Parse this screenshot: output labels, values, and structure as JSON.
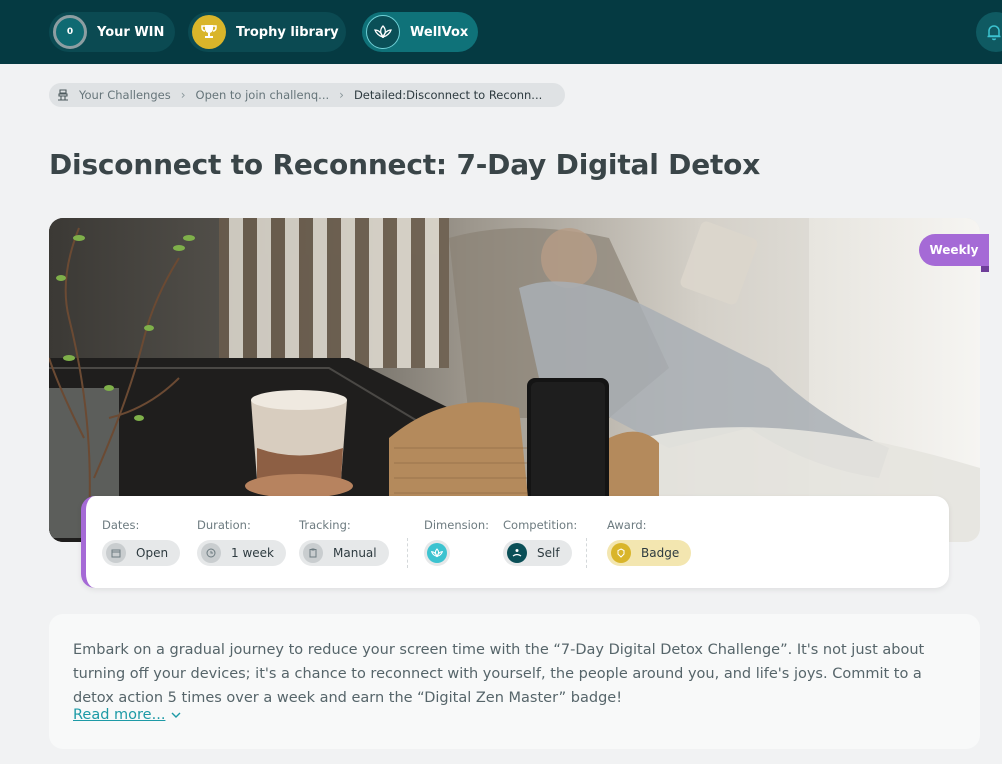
{
  "nav": {
    "win_count": "0",
    "win_label": "Your WIN",
    "trophy_label": "Trophy library",
    "wellvox_label": "WellVox"
  },
  "breadcrumb": {
    "items": [
      "Your Challenges",
      "Open to join challenq...",
      "Detailed:Disconnect to Reconn..."
    ]
  },
  "page": {
    "title": "Disconnect to Reconnect: 7-Day Digital Detox",
    "frequency_tag": "Weekly"
  },
  "details": {
    "dates_label": "Dates:",
    "dates_value": "Open",
    "duration_label": "Duration:",
    "duration_value": "1 week",
    "tracking_label": "Tracking:",
    "tracking_value": "Manual",
    "dimension_label": "Dimension:",
    "competition_label": "Competition:",
    "competition_value": "Self",
    "award_label": "Award:",
    "award_value": "Badge"
  },
  "description": {
    "text": "Embark on a gradual journey to reduce your screen time with the “7-Day Digital Detox Challenge”. It's not just about turning off your devices; it's a chance to reconnect with yourself, the people around you, and life's joys. Commit to a detox action 5 times over a week and earn the “Digital Zen Master” badge!",
    "read_more": "Read more..."
  },
  "colors": {
    "topbar": "#053a42",
    "accent_purple": "#a56ad6",
    "link": "#1d9aa6",
    "trophy_gold": "#d9b52a"
  }
}
